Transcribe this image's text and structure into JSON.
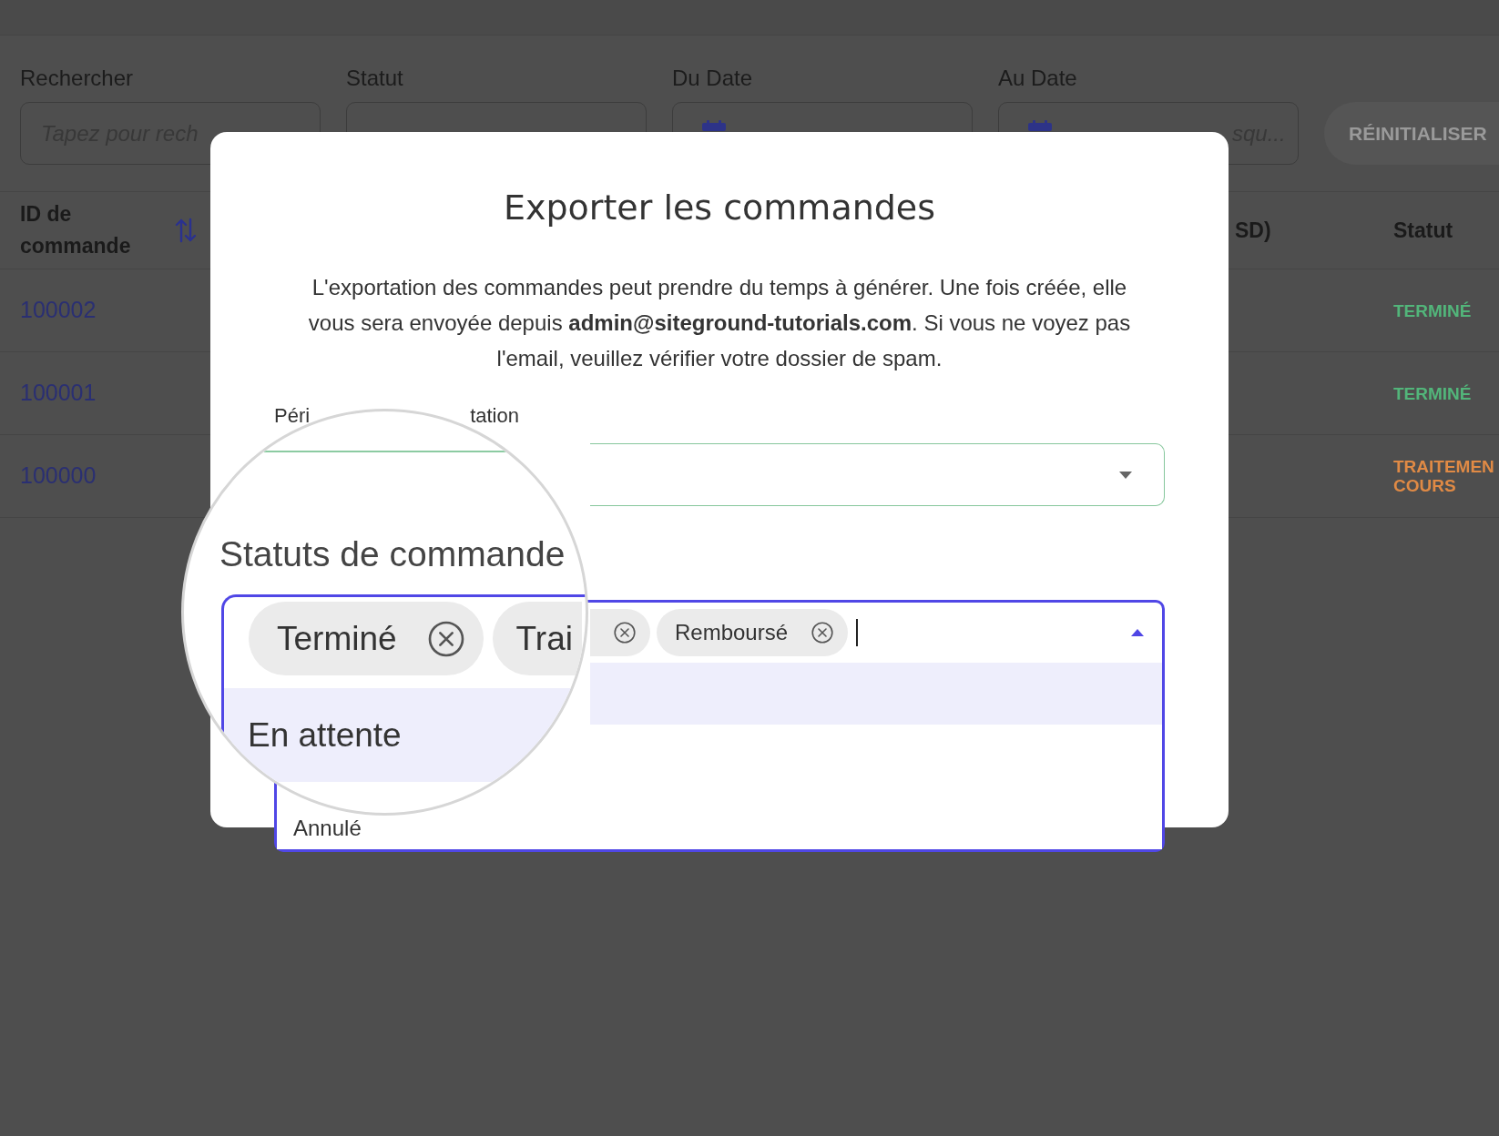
{
  "filters": [
    {
      "kind": "text",
      "label": "Rechercher",
      "placeholder": "Tapez pour rech"
    },
    {
      "kind": "select",
      "label": "Statut"
    },
    {
      "kind": "date",
      "label": "Du Date"
    },
    {
      "kind": "date",
      "label": "Au Date",
      "placeholder": "squ..."
    }
  ],
  "reset_button": "RÉINITIALISER",
  "table": {
    "columns": [
      {
        "label": "ID de commande",
        "sortable": true
      },
      {
        "label": "SD)",
        "sortable": false
      },
      {
        "label": "Statut",
        "sortable": false
      }
    ],
    "rows": [
      {
        "order_id": "100002",
        "status": {
          "label": "TERMINÉ",
          "color": "#52b57a"
        }
      },
      {
        "order_id": "100001",
        "status": {
          "label": "TERMINÉ",
          "color": "#52b57a"
        }
      },
      {
        "order_id": "100000",
        "status": {
          "label": "TRAITEMEN COURS",
          "color": "#e08a45"
        }
      }
    ]
  },
  "export_modal": {
    "title": "Exporter les commandes",
    "description": "L'exportation des commandes peut prendre du temps à générer. Une fois créée, elle vous sera envoyée depuis **admin@siteground-tutorials.com**. Si vous ne voyez pas l'email, veuillez vérifier votre dossier de spam.",
    "period_field": {
      "label_fragments": [
        "Péri",
        "tation"
      ],
      "expanded": false
    },
    "status_field": {
      "focused": true,
      "expanded": true,
      "tags": [
        {
          "kind": "icon_only"
        },
        {
          "kind": "full",
          "label": "Remboursé"
        }
      ],
      "options": [
        {
          "highlighted": true
        },
        {
          "label": "Annulé",
          "highlighted": false
        }
      ]
    }
  },
  "magnifier": {
    "label": "Statuts de commande",
    "tags": [
      {
        "kind": "full",
        "label": "Terminé"
      },
      {
        "kind": "label_only",
        "label": "Trai"
      }
    ],
    "options": [
      {
        "label": "En attente",
        "highlighted": true
      }
    ]
  }
}
